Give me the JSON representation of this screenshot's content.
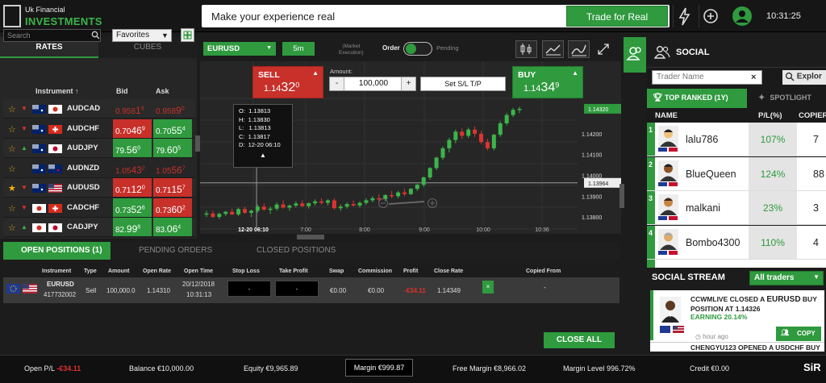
{
  "brand": {
    "line1": "Uk Financial",
    "line2": "INVESTMENTS"
  },
  "topbar": {
    "promo_text": "Make your experience real",
    "trade_button": "Trade for Real",
    "clock": "10:31:25"
  },
  "icons": {
    "topbar": [
      "lightning-icon",
      "plus-circle-icon",
      "user-icon"
    ]
  },
  "left_panel": {
    "tabs": [
      "RATES",
      "CUBES"
    ],
    "search_placeholder": "Search",
    "favorites": "Favorites",
    "headers": {
      "instrument": "Instrument",
      "bid": "Bid",
      "ask": "Ask"
    },
    "rows": [
      {
        "sym": "AUDCAD",
        "star": false,
        "dir": "down",
        "flags": [
          "au",
          "ca"
        ],
        "bid_a": "0.958",
        "bid_b": "1",
        "bid_c": "9",
        "ask_a": "0.958",
        "ask_b": "9",
        "ask_c": "0",
        "style": "plain"
      },
      {
        "sym": "AUDCHF",
        "star": false,
        "dir": "down",
        "flags": [
          "au",
          "ch"
        ],
        "bid_a": "0.70",
        "bid_b": "46",
        "bid_c": "9",
        "ask_a": "0.70",
        "ask_b": "55",
        "ask_c": "4",
        "style": "redgreen"
      },
      {
        "sym": "AUDJPY",
        "star": false,
        "dir": "up",
        "flags": [
          "au",
          "jp"
        ],
        "bid_a": "79.",
        "bid_b": "56",
        "bid_c": "0",
        "ask_a": "79.",
        "ask_b": "60",
        "ask_c": "5",
        "style": "greengreen"
      },
      {
        "sym": "AUDNZD",
        "star": false,
        "dir": "none",
        "flags": [
          "au",
          "nz"
        ],
        "bid_a": "1.05",
        "bid_b": "43",
        "bid_c": "2",
        "ask_a": "1.05",
        "ask_b": "56",
        "ask_c": "7",
        "style": "plain"
      },
      {
        "sym": "AUDUSD",
        "star": true,
        "dir": "down",
        "flags": [
          "au",
          "us"
        ],
        "bid_a": "0.71",
        "bid_b": "12",
        "bid_c": "0",
        "ask_a": "0.71",
        "ask_b": "15",
        "ask_c": "7",
        "style": "redred"
      },
      {
        "sym": "CADCHF",
        "star": false,
        "dir": "down",
        "flags": [
          "ca",
          "ch"
        ],
        "bid_a": "0.73",
        "bid_b": "52",
        "bid_c": "6",
        "ask_a": "0.73",
        "ask_b": "60",
        "ask_c": "2",
        "style": "greenred"
      },
      {
        "sym": "CADJPY",
        "star": false,
        "dir": "up",
        "flags": [
          "ca",
          "jp"
        ],
        "bid_a": "82.",
        "bid_b": "99",
        "bid_c": "8",
        "ask_a": "83.",
        "ask_b": "06",
        "ask_c": "4",
        "style": "greengreen"
      }
    ]
  },
  "chart_toolbar": {
    "pair": "EURUSD",
    "timeframe": "5m",
    "market_exec": "(Market\nExecution)",
    "order": "Order",
    "pending": "Pending"
  },
  "sell": {
    "label": "SELL",
    "price_a": "1.14",
    "price_b": "32",
    "price_c": "0"
  },
  "buy": {
    "label": "BUY",
    "price_a": "1.14",
    "price_b": "34",
    "price_c": "9"
  },
  "amount": {
    "label": "Amount:",
    "value": "100,000",
    "minus": "-",
    "plus": "+",
    "sltp": "Set S/L T/P"
  },
  "ohlc": {
    "O": "1.13813",
    "H": "1.13830",
    "L": "1.13813",
    "C": "1.13817",
    "D": "12-20 06:10"
  },
  "chart_data": {
    "type": "candlestick",
    "x_ticks": [
      "12-20 06:10",
      "7:00",
      "8:00",
      "9:00",
      "10:00",
      "10:36"
    ],
    "y_ticks": [
      "1.14320",
      "1.14200",
      "1.14100",
      "1.14000",
      "1.13964",
      "1.13900",
      "1.13800"
    ],
    "ylim": [
      1.1375,
      1.1437
    ],
    "current_price": "1.14320",
    "crosshair_price": "1.13964",
    "candles": [
      [
        1.13813,
        1.1383,
        1.138,
        1.13817
      ],
      [
        1.13817,
        1.1383,
        1.13795,
        1.138
      ],
      [
        1.138,
        1.13822,
        1.1379,
        1.13815
      ],
      [
        1.13815,
        1.1383,
        1.13805,
        1.13825
      ],
      [
        1.13825,
        1.1384,
        1.1381,
        1.13812
      ],
      [
        1.13812,
        1.13845,
        1.13805,
        1.13838
      ],
      [
        1.13838,
        1.1385,
        1.13815,
        1.1382
      ],
      [
        1.1382,
        1.13835,
        1.138,
        1.1383
      ],
      [
        1.1383,
        1.1386,
        1.1382,
        1.1385
      ],
      [
        1.1385,
        1.13865,
        1.1383,
        1.13835
      ],
      [
        1.13835,
        1.1385,
        1.13815,
        1.1384
      ],
      [
        1.1384,
        1.1387,
        1.1383,
        1.1386
      ],
      [
        1.1386,
        1.1388,
        1.1384,
        1.13845
      ],
      [
        1.13845,
        1.1386,
        1.1383,
        1.13855
      ],
      [
        1.13855,
        1.13875,
        1.13845,
        1.13865
      ],
      [
        1.13865,
        1.1388,
        1.13848,
        1.13852
      ],
      [
        1.13852,
        1.1387,
        1.1384,
        1.13866
      ],
      [
        1.13866,
        1.13885,
        1.13855,
        1.13875
      ],
      [
        1.13875,
        1.1389,
        1.1386,
        1.13868
      ],
      [
        1.13868,
        1.13885,
        1.13855,
        1.1388
      ],
      [
        1.1388,
        1.1389,
        1.13835,
        1.13842
      ],
      [
        1.13842,
        1.1386,
        1.1383,
        1.1385
      ],
      [
        1.1385,
        1.1387,
        1.1384,
        1.13862
      ],
      [
        1.13862,
        1.1388,
        1.1385,
        1.13855
      ],
      [
        1.13855,
        1.13875,
        1.13845,
        1.13868
      ],
      [
        1.13868,
        1.1389,
        1.13858,
        1.1388
      ],
      [
        1.1388,
        1.139,
        1.1387,
        1.1389
      ],
      [
        1.1389,
        1.1391,
        1.13875,
        1.13885
      ],
      [
        1.13885,
        1.1391,
        1.13875,
        1.13905
      ],
      [
        1.13905,
        1.13925,
        1.1389,
        1.139
      ],
      [
        1.139,
        1.13925,
        1.1389,
        1.13918
      ],
      [
        1.13918,
        1.13935,
        1.139,
        1.1391
      ],
      [
        1.1391,
        1.1394,
        1.13905,
        1.13935
      ],
      [
        1.13935,
        1.1396,
        1.13925,
        1.13955
      ],
      [
        1.13955,
        1.13995,
        1.13945,
        1.1399
      ],
      [
        1.1399,
        1.1404,
        1.1398,
        1.14035
      ],
      [
        1.14035,
        1.1409,
        1.14025,
        1.14085
      ],
      [
        1.14085,
        1.1414,
        1.14075,
        1.1413
      ],
      [
        1.1413,
        1.1418,
        1.1411,
        1.1417
      ],
      [
        1.1417,
        1.1422,
        1.14155,
        1.1421
      ],
      [
        1.1421,
        1.14225,
        1.14175,
        1.1419
      ],
      [
        1.1419,
        1.1423,
        1.1418,
        1.1422
      ],
      [
        1.1422,
        1.14235,
        1.14185,
        1.142
      ],
      [
        1.142,
        1.14215,
        1.1415,
        1.1416
      ],
      [
        1.1416,
        1.14175,
        1.1412,
        1.1413
      ],
      [
        1.1413,
        1.142,
        1.1412,
        1.14195
      ],
      [
        1.14195,
        1.1426,
        1.14185,
        1.1425
      ],
      [
        1.1425,
        1.143,
        1.1424,
        1.1429
      ],
      [
        1.1429,
        1.14325,
        1.1428,
        1.14315
      ],
      [
        1.14315,
        1.1433,
        1.143,
        1.1432
      ]
    ]
  },
  "positions": {
    "tabs": [
      "OPEN POSITIONS (1)",
      "PENDING ORDERS",
      "CLOSED POSITIONS"
    ],
    "headers": [
      "Instrument",
      "Type",
      "Amount",
      "Open Rate",
      "Open Time",
      "Stop Loss",
      "Take Profit",
      "Swap",
      "Commission",
      "Profit",
      "Close Rate",
      "Copied From"
    ],
    "row": {
      "instrument": "EURUSD",
      "id": "417732002",
      "type": "Sell",
      "amount": "100,000.0",
      "open_rate": "1.14310",
      "open_date": "20/12/2018",
      "open_clock": "10:31:13",
      "stop_loss": "-",
      "take_profit": "-",
      "swap": "€0.00",
      "commission": "€0.00",
      "profit": "-€34.11",
      "close_rate": "1.14349",
      "close_x": "×",
      "copied_from": "-"
    },
    "close_all": "CLOSE ALL"
  },
  "footer": {
    "open_pl_label": "Open P/L",
    "open_pl": "-€34.11",
    "balance": "Balance €10,000.00",
    "equity": "Equity €9,965.89",
    "margin": "Margin €999.87",
    "free_margin": "Free Margin €8,966.02",
    "margin_level": "Margin Level 996.72%",
    "credit": "Credit €0.00",
    "logo": "SiR"
  },
  "social": {
    "title": "SOCIAL",
    "search_placeholder": "Trader Name",
    "explore": "Explor",
    "tab_top": "TOP RANKED (1Y)",
    "tab_spot": "SPOTLIGHT",
    "headers": {
      "name": "NAME",
      "pl": "P/L(%)",
      "copiers": "COPIER"
    },
    "rows": [
      {
        "rank": "1",
        "name": "lalu786",
        "pl": "107%",
        "copiers": "7"
      },
      {
        "rank": "2",
        "name": "BlueQueen",
        "pl": "124%",
        "copiers": "88"
      },
      {
        "rank": "3",
        "name": "malkani",
        "pl": "23%",
        "copiers": "3"
      },
      {
        "rank": "4",
        "name": "Bombo4300",
        "pl": "110%",
        "copiers": "4"
      }
    ],
    "stream_title": "SOCIAL STREAM",
    "stream_filter": "All traders",
    "feed1_line1": "CCWMLIVE CLOSED A",
    "feed1_pair": "EURUSD",
    "feed1_line1b": "BUY",
    "feed1_line2": "POSITION AT 1.14326",
    "feed1_earn": "EARNING 20.14%",
    "feed1_time": "hour ago",
    "feed1_copy": "COPY",
    "feed2": "CHENGYU123 OPENED A USDCHF BUY"
  }
}
